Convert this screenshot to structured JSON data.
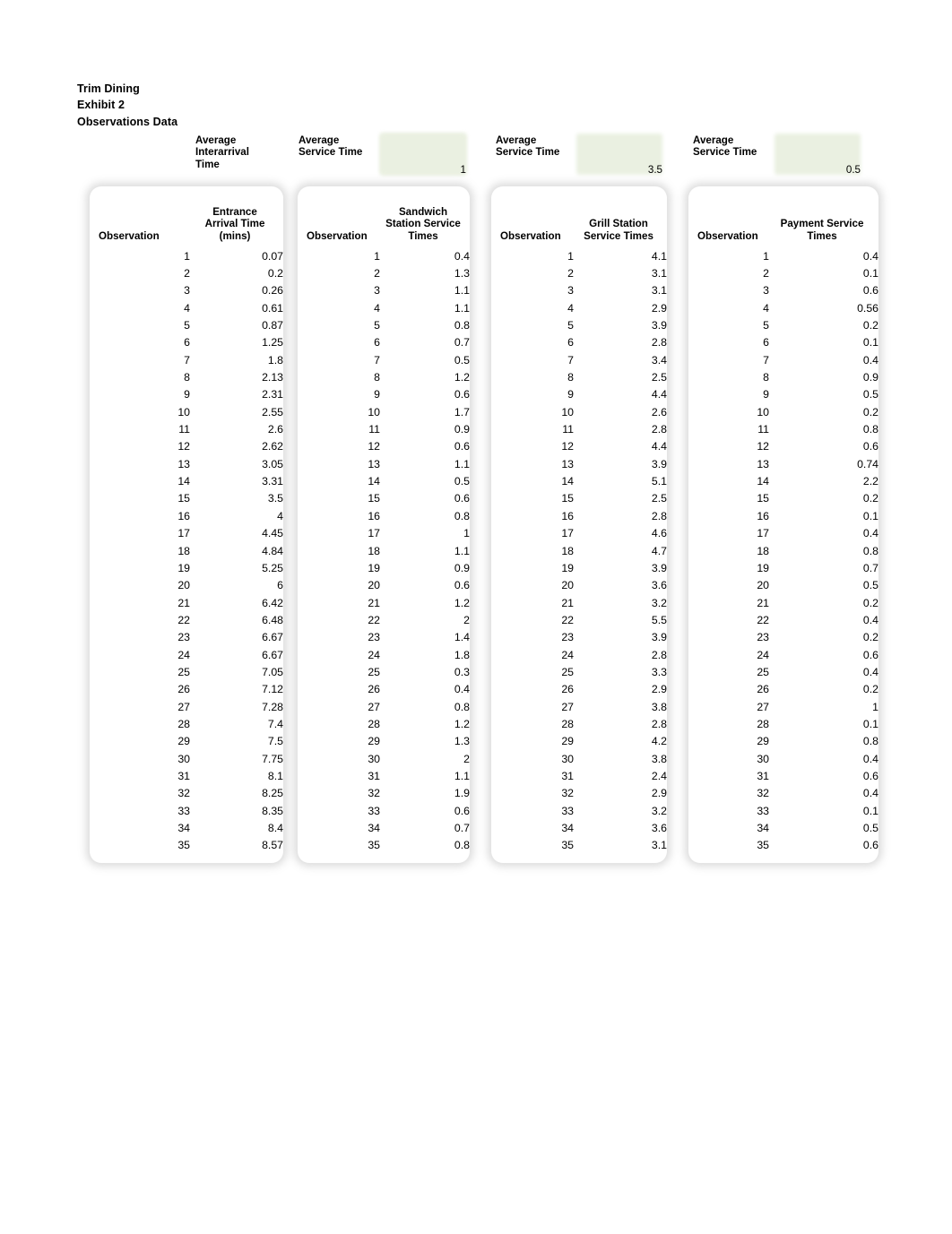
{
  "document": {
    "title_lines": {
      "line1": "Trim Dining",
      "line2": "Exhibit 2",
      "line3": "Observations Data"
    }
  },
  "highlight_color": "#eaf0e1",
  "summary": {
    "cells": [
      {
        "label": "Average\nInterarrival\nTime",
        "value": ""
      },
      {
        "label": "Average\nService Time",
        "value": "1"
      },
      {
        "label": "Average\nService Time",
        "value": "3.5"
      },
      {
        "label": "Average\nService Time",
        "value": "0.5"
      }
    ]
  },
  "tables": [
    {
      "id": "entrance-arrival-time",
      "header_obs": "Observation",
      "header_val": "Entrance\nArrival Time\n(mins)",
      "rows": [
        {
          "obs": "1",
          "val": "0.07"
        },
        {
          "obs": "2",
          "val": "0.2"
        },
        {
          "obs": "3",
          "val": "0.26"
        },
        {
          "obs": "4",
          "val": "0.61"
        },
        {
          "obs": "5",
          "val": "0.87"
        },
        {
          "obs": "6",
          "val": "1.25"
        },
        {
          "obs": "7",
          "val": "1.8"
        },
        {
          "obs": "8",
          "val": "2.13"
        },
        {
          "obs": "9",
          "val": "2.31"
        },
        {
          "obs": "10",
          "val": "2.55"
        },
        {
          "obs": "11",
          "val": "2.6"
        },
        {
          "obs": "12",
          "val": "2.62"
        },
        {
          "obs": "13",
          "val": "3.05"
        },
        {
          "obs": "14",
          "val": "3.31"
        },
        {
          "obs": "15",
          "val": "3.5"
        },
        {
          "obs": "16",
          "val": "4"
        },
        {
          "obs": "17",
          "val": "4.45"
        },
        {
          "obs": "18",
          "val": "4.84"
        },
        {
          "obs": "19",
          "val": "5.25"
        },
        {
          "obs": "20",
          "val": "6"
        },
        {
          "obs": "21",
          "val": "6.42"
        },
        {
          "obs": "22",
          "val": "6.48"
        },
        {
          "obs": "23",
          "val": "6.67"
        },
        {
          "obs": "24",
          "val": "6.67"
        },
        {
          "obs": "25",
          "val": "7.05"
        },
        {
          "obs": "26",
          "val": "7.12"
        },
        {
          "obs": "27",
          "val": "7.28"
        },
        {
          "obs": "28",
          "val": "7.4"
        },
        {
          "obs": "29",
          "val": "7.5"
        },
        {
          "obs": "30",
          "val": "7.75"
        },
        {
          "obs": "31",
          "val": "8.1"
        },
        {
          "obs": "32",
          "val": "8.25"
        },
        {
          "obs": "33",
          "val": "8.35"
        },
        {
          "obs": "34",
          "val": "8.4"
        },
        {
          "obs": "35",
          "val": "8.57"
        }
      ]
    },
    {
      "id": "sandwich-station-service-times",
      "header_obs": "Observation",
      "header_val": "Sandwich\nStation Service\nTimes",
      "rows": [
        {
          "obs": "1",
          "val": "0.4"
        },
        {
          "obs": "2",
          "val": "1.3"
        },
        {
          "obs": "3",
          "val": "1.1"
        },
        {
          "obs": "4",
          "val": "1.1"
        },
        {
          "obs": "5",
          "val": "0.8"
        },
        {
          "obs": "6",
          "val": "0.7"
        },
        {
          "obs": "7",
          "val": "0.5"
        },
        {
          "obs": "8",
          "val": "1.2"
        },
        {
          "obs": "9",
          "val": "0.6"
        },
        {
          "obs": "10",
          "val": "1.7"
        },
        {
          "obs": "11",
          "val": "0.9"
        },
        {
          "obs": "12",
          "val": "0.6"
        },
        {
          "obs": "13",
          "val": "1.1"
        },
        {
          "obs": "14",
          "val": "0.5"
        },
        {
          "obs": "15",
          "val": "0.6"
        },
        {
          "obs": "16",
          "val": "0.8"
        },
        {
          "obs": "17",
          "val": "1"
        },
        {
          "obs": "18",
          "val": "1.1"
        },
        {
          "obs": "19",
          "val": "0.9"
        },
        {
          "obs": "20",
          "val": "0.6"
        },
        {
          "obs": "21",
          "val": "1.2"
        },
        {
          "obs": "22",
          "val": "2"
        },
        {
          "obs": "23",
          "val": "1.4"
        },
        {
          "obs": "24",
          "val": "1.8"
        },
        {
          "obs": "25",
          "val": "0.3"
        },
        {
          "obs": "26",
          "val": "0.4"
        },
        {
          "obs": "27",
          "val": "0.8"
        },
        {
          "obs": "28",
          "val": "1.2"
        },
        {
          "obs": "29",
          "val": "1.3"
        },
        {
          "obs": "30",
          "val": "2"
        },
        {
          "obs": "31",
          "val": "1.1"
        },
        {
          "obs": "32",
          "val": "1.9"
        },
        {
          "obs": "33",
          "val": "0.6"
        },
        {
          "obs": "34",
          "val": "0.7"
        },
        {
          "obs": "35",
          "val": "0.8"
        }
      ]
    },
    {
      "id": "grill-station-service-times",
      "header_obs": "Observation",
      "header_val": "Grill Station\nService Times",
      "rows": [
        {
          "obs": "1",
          "val": "4.1"
        },
        {
          "obs": "2",
          "val": "3.1"
        },
        {
          "obs": "3",
          "val": "3.1"
        },
        {
          "obs": "4",
          "val": "2.9"
        },
        {
          "obs": "5",
          "val": "3.9"
        },
        {
          "obs": "6",
          "val": "2.8"
        },
        {
          "obs": "7",
          "val": "3.4"
        },
        {
          "obs": "8",
          "val": "2.5"
        },
        {
          "obs": "9",
          "val": "4.4"
        },
        {
          "obs": "10",
          "val": "2.6"
        },
        {
          "obs": "11",
          "val": "2.8"
        },
        {
          "obs": "12",
          "val": "4.4"
        },
        {
          "obs": "13",
          "val": "3.9"
        },
        {
          "obs": "14",
          "val": "5.1"
        },
        {
          "obs": "15",
          "val": "2.5"
        },
        {
          "obs": "16",
          "val": "2.8"
        },
        {
          "obs": "17",
          "val": "4.6"
        },
        {
          "obs": "18",
          "val": "4.7"
        },
        {
          "obs": "19",
          "val": "3.9"
        },
        {
          "obs": "20",
          "val": "3.6"
        },
        {
          "obs": "21",
          "val": "3.2"
        },
        {
          "obs": "22",
          "val": "5.5"
        },
        {
          "obs": "23",
          "val": "3.9"
        },
        {
          "obs": "24",
          "val": "2.8"
        },
        {
          "obs": "25",
          "val": "3.3"
        },
        {
          "obs": "26",
          "val": "2.9"
        },
        {
          "obs": "27",
          "val": "3.8"
        },
        {
          "obs": "28",
          "val": "2.8"
        },
        {
          "obs": "29",
          "val": "4.2"
        },
        {
          "obs": "30",
          "val": "3.8"
        },
        {
          "obs": "31",
          "val": "2.4"
        },
        {
          "obs": "32",
          "val": "2.9"
        },
        {
          "obs": "33",
          "val": "3.2"
        },
        {
          "obs": "34",
          "val": "3.6"
        },
        {
          "obs": "35",
          "val": "3.1"
        }
      ]
    },
    {
      "id": "payment-service-times",
      "header_obs": "Observation",
      "header_val": "Payment Service\nTimes",
      "rows": [
        {
          "obs": "1",
          "val": "0.4"
        },
        {
          "obs": "2",
          "val": "0.1"
        },
        {
          "obs": "3",
          "val": "0.6"
        },
        {
          "obs": "4",
          "val": "0.56"
        },
        {
          "obs": "5",
          "val": "0.2"
        },
        {
          "obs": "6",
          "val": "0.1"
        },
        {
          "obs": "7",
          "val": "0.4"
        },
        {
          "obs": "8",
          "val": "0.9"
        },
        {
          "obs": "9",
          "val": "0.5"
        },
        {
          "obs": "10",
          "val": "0.2"
        },
        {
          "obs": "11",
          "val": "0.8"
        },
        {
          "obs": "12",
          "val": "0.6"
        },
        {
          "obs": "13",
          "val": "0.74"
        },
        {
          "obs": "14",
          "val": "2.2"
        },
        {
          "obs": "15",
          "val": "0.2"
        },
        {
          "obs": "16",
          "val": "0.1"
        },
        {
          "obs": "17",
          "val": "0.4"
        },
        {
          "obs": "18",
          "val": "0.8"
        },
        {
          "obs": "19",
          "val": "0.7"
        },
        {
          "obs": "20",
          "val": "0.5"
        },
        {
          "obs": "21",
          "val": "0.2"
        },
        {
          "obs": "22",
          "val": "0.4"
        },
        {
          "obs": "23",
          "val": "0.2"
        },
        {
          "obs": "24",
          "val": "0.6"
        },
        {
          "obs": "25",
          "val": "0.4"
        },
        {
          "obs": "26",
          "val": "0.2"
        },
        {
          "obs": "27",
          "val": "1"
        },
        {
          "obs": "28",
          "val": "0.1"
        },
        {
          "obs": "29",
          "val": "0.8"
        },
        {
          "obs": "30",
          "val": "0.4"
        },
        {
          "obs": "31",
          "val": "0.6"
        },
        {
          "obs": "32",
          "val": "0.4"
        },
        {
          "obs": "33",
          "val": "0.1"
        },
        {
          "obs": "34",
          "val": "0.5"
        },
        {
          "obs": "35",
          "val": "0.6"
        }
      ]
    }
  ]
}
